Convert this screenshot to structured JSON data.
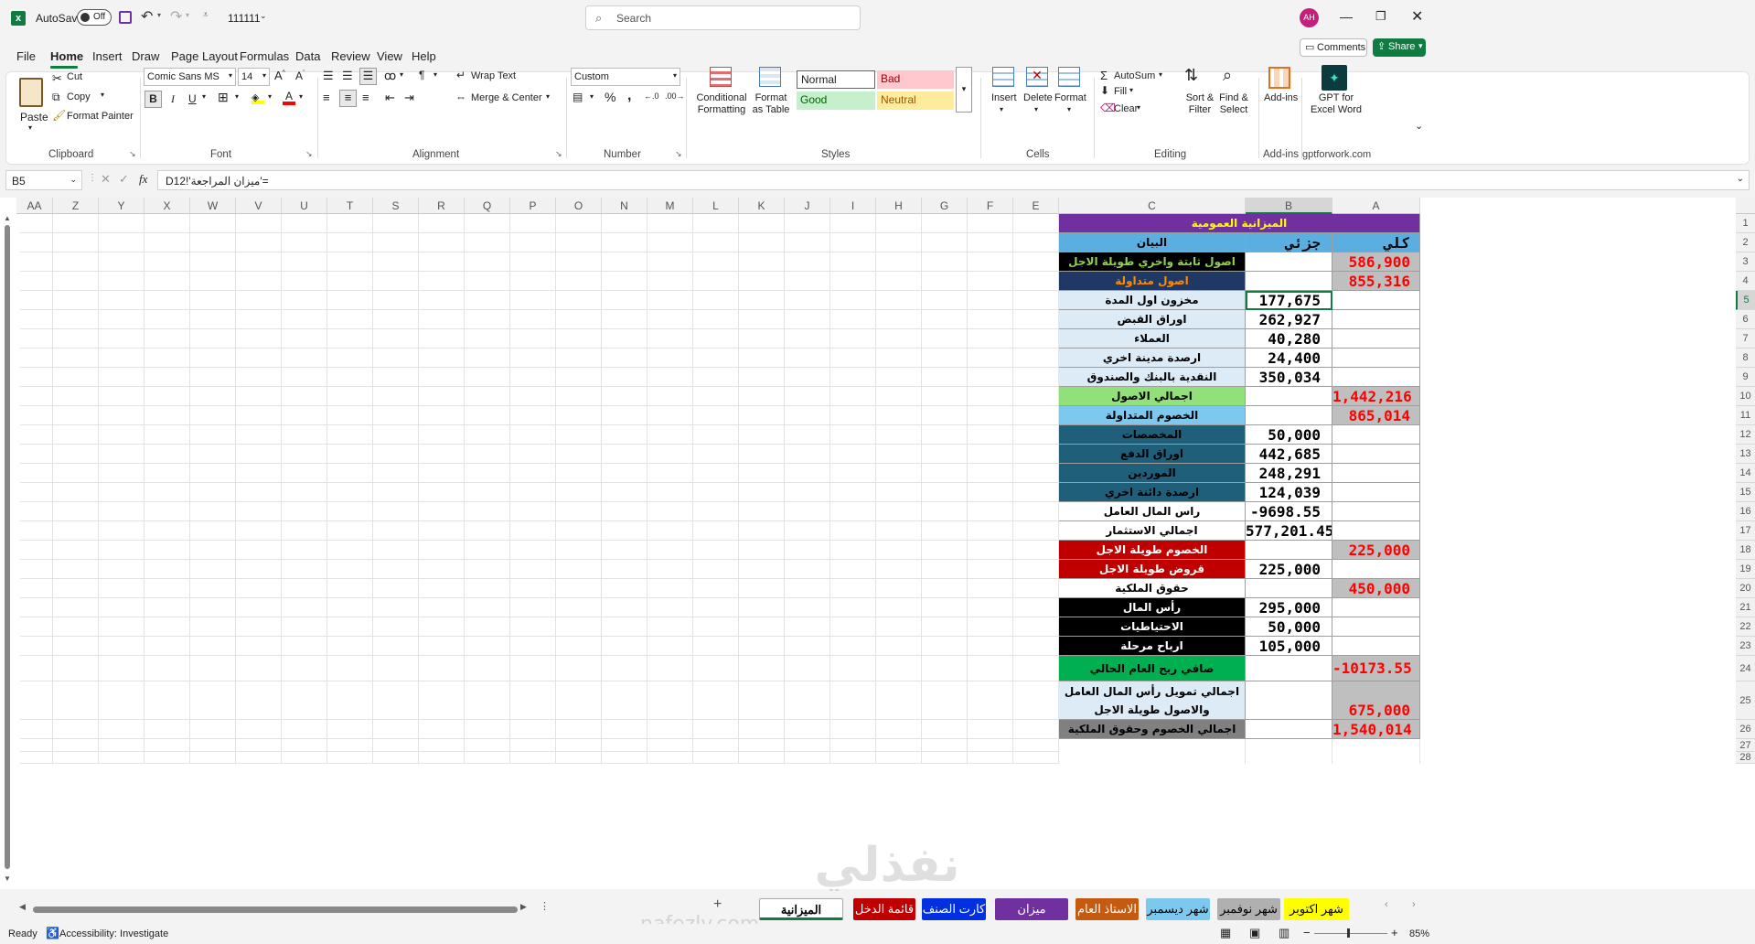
{
  "titlebar": {
    "autosave_label": "AutoSave",
    "autosave_state": "Off",
    "filename": "111111",
    "search_placeholder": "Search",
    "user_initials": "AH"
  },
  "ribbon_tabs": [
    "File",
    "Home",
    "Insert",
    "Draw",
    "Page Layout",
    "Formulas",
    "Data",
    "Review",
    "View",
    "Help"
  ],
  "active_tab": "Home",
  "top_right": {
    "comments": "Comments",
    "share": "Share"
  },
  "clipboard": {
    "paste": "Paste",
    "cut": "Cut",
    "copy": "Copy",
    "format_painter": "Format Painter",
    "label": "Clipboard"
  },
  "font": {
    "name": "Comic Sans MS",
    "size": "14",
    "label": "Font",
    "bold": "B",
    "italic": "I",
    "underline": "U"
  },
  "alignment": {
    "wrap_text": "Wrap Text",
    "merge_center": "Merge & Center",
    "label": "Alignment"
  },
  "number": {
    "format": "Custom",
    "label": "Number"
  },
  "styles": {
    "conditional": "Conditional Formatting",
    "format_table": "Format as Table",
    "normal": "Normal",
    "bad": "Bad",
    "good": "Good",
    "neutral": "Neutral",
    "label": "Styles"
  },
  "cells": {
    "insert": "Insert",
    "delete": "Delete",
    "format": "Format",
    "label": "Cells"
  },
  "editing": {
    "autosum": "AutoSum",
    "fill": "Fill",
    "clear": "Clear",
    "sort_filter": "Sort & Filter",
    "find_select": "Find & Select",
    "label": "Editing"
  },
  "addins": {
    "addins": "Add-ins",
    "label": "Add-ins",
    "gpt": "GPT for Excel Word",
    "gpt_label": "gptforwork.com"
  },
  "formula_bar": {
    "name_box": "B5",
    "fx": "fx",
    "formula": "='ميزان المراجعة'!D12"
  },
  "columns": [
    "AA",
    "Z",
    "Y",
    "X",
    "W",
    "V",
    "U",
    "T",
    "S",
    "R",
    "Q",
    "P",
    "O",
    "N",
    "M",
    "L",
    "K",
    "J",
    "I",
    "H",
    "G",
    "F",
    "E",
    "C",
    "B",
    "A"
  ],
  "rows": [
    {
      "n": "1",
      "c": "الميزانية العمومية",
      "b": "",
      "a": "",
      "fill": "#7030a0",
      "cc": "#ffff00",
      "bc": "#000",
      "ac": "#000",
      "merged": true
    },
    {
      "n": "2",
      "c": "البيان",
      "b": "جزئي",
      "a": "كلي",
      "fill": "#5aaee0",
      "cc": "#000",
      "bc": "#000",
      "ac": "#000",
      "bfill": "#5aaee0",
      "afill": "#5aaee0"
    },
    {
      "n": "3",
      "c": "اصول ثابتة واخري طويلة الاجل",
      "b": "",
      "a": "586,900",
      "fill": "#000000",
      "cc": "#92d050",
      "bc": "#000",
      "ac": "#ff0000",
      "bfill": "#fff",
      "afill": "#bfbfbf"
    },
    {
      "n": "4",
      "c": "اصول متداولة",
      "b": "",
      "a": "855,316",
      "fill": "#1f3864",
      "cc": "#ff8c00",
      "bc": "#000",
      "ac": "#ff0000",
      "bfill": "#fff",
      "afill": "#bfbfbf"
    },
    {
      "n": "5",
      "c": "مخزون اول المدة",
      "b": "177,675",
      "a": "",
      "fill": "#ddebf7",
      "cc": "#000",
      "bc": "#000",
      "ac": "#000",
      "bfill": "#fff",
      "afill": "#fff"
    },
    {
      "n": "6",
      "c": "اوراق القبض",
      "b": "262,927",
      "a": "",
      "fill": "#ddebf7",
      "cc": "#000",
      "bc": "#000",
      "ac": "#000",
      "bfill": "#fff",
      "afill": "#fff"
    },
    {
      "n": "7",
      "c": "العملاء",
      "b": "40,280",
      "a": "",
      "fill": "#ddebf7",
      "cc": "#000",
      "bc": "#000",
      "ac": "#000",
      "bfill": "#fff",
      "afill": "#fff"
    },
    {
      "n": "8",
      "c": "ارصدة مدينة اخري",
      "b": "24,400",
      "a": "",
      "fill": "#ddebf7",
      "cc": "#000",
      "bc": "#000",
      "ac": "#000",
      "bfill": "#fff",
      "afill": "#fff"
    },
    {
      "n": "9",
      "c": "النقدية بالبنك والصندوق",
      "b": "350,034",
      "a": "",
      "fill": "#ddebf7",
      "cc": "#000",
      "bc": "#000",
      "ac": "#000",
      "bfill": "#fff",
      "afill": "#fff"
    },
    {
      "n": "10",
      "c": "اجمالي الاصول",
      "b": "",
      "a": "1,442,216",
      "fill": "#92e07a",
      "cc": "#000",
      "bc": "#000",
      "ac": "#ff0000",
      "bfill": "#fff",
      "afill": "#bfbfbf"
    },
    {
      "n": "11",
      "c": "الخصوم المتداولة",
      "b": "",
      "a": "865,014",
      "fill": "#7cc8ef",
      "cc": "#000",
      "bc": "#000",
      "ac": "#ff0000",
      "bfill": "#fff",
      "afill": "#bfbfbf"
    },
    {
      "n": "12",
      "c": "المخصصات",
      "b": "50,000",
      "a": "",
      "fill": "#1f5f7a",
      "cc": "#000",
      "bc": "#000",
      "ac": "#000",
      "bfill": "#fff",
      "afill": "#fff"
    },
    {
      "n": "13",
      "c": "اوراق الدفع",
      "b": "442,685",
      "a": "",
      "fill": "#1f5f7a",
      "cc": "#000",
      "bc": "#000",
      "ac": "#000",
      "bfill": "#fff",
      "afill": "#fff"
    },
    {
      "n": "14",
      "c": "الموردين",
      "b": "248,291",
      "a": "",
      "fill": "#1f5f7a",
      "cc": "#000",
      "bc": "#000",
      "ac": "#000",
      "bfill": "#fff",
      "afill": "#fff"
    },
    {
      "n": "15",
      "c": "ارصدة دائنة اخري",
      "b": "124,039",
      "a": "",
      "fill": "#1f5f7a",
      "cc": "#000",
      "bc": "#000",
      "ac": "#000",
      "bfill": "#fff",
      "afill": "#fff"
    },
    {
      "n": "16",
      "c": "راس المال العامل",
      "b": "-9698.55",
      "a": "",
      "fill": "#ffffff",
      "cc": "#000",
      "bc": "#000",
      "ac": "#000",
      "bfill": "#fff",
      "afill": "#fff"
    },
    {
      "n": "17",
      "c": "اجمالي الاستثمار",
      "b": "577,201.45",
      "a": "",
      "fill": "#ffffff",
      "cc": "#000",
      "bc": "#000",
      "ac": "#000",
      "bfill": "#fff",
      "afill": "#fff"
    },
    {
      "n": "18",
      "c": "الخصوم طويلة الاجل",
      "b": "",
      "a": "225,000",
      "fill": "#c00000",
      "cc": "#ffffff",
      "bc": "#000",
      "ac": "#ff0000",
      "bfill": "#fff",
      "afill": "#bfbfbf"
    },
    {
      "n": "19",
      "c": "قروض طويلة الاجل",
      "b": "225,000",
      "a": "",
      "fill": "#c00000",
      "cc": "#ffffff",
      "bc": "#000",
      "ac": "#000",
      "bfill": "#fff",
      "afill": "#fff"
    },
    {
      "n": "20",
      "c": "حقوق الملكية",
      "b": "",
      "a": "450,000",
      "fill": "#ffffff",
      "cc": "#000",
      "bc": "#000",
      "ac": "#ff0000",
      "bfill": "#fff",
      "afill": "#bfbfbf"
    },
    {
      "n": "21",
      "c": "رأس المال",
      "b": "295,000",
      "a": "",
      "fill": "#000000",
      "cc": "#ffffff",
      "bc": "#000",
      "ac": "#000",
      "bfill": "#fff",
      "afill": "#fff"
    },
    {
      "n": "22",
      "c": "الاحتياطيات",
      "b": "50,000",
      "a": "",
      "fill": "#000000",
      "cc": "#ffffff",
      "bc": "#000",
      "ac": "#000",
      "bfill": "#fff",
      "afill": "#fff"
    },
    {
      "n": "23",
      "c": "ارباح مرحلة",
      "b": "105,000",
      "a": "",
      "fill": "#000000",
      "cc": "#ffffff",
      "bc": "#000",
      "ac": "#000",
      "bfill": "#fff",
      "afill": "#fff"
    },
    {
      "n": "24",
      "c": "صافي ربح العام الحالي",
      "b": "",
      "a": "-10173.55",
      "fill": "#00b050",
      "cc": "#000",
      "bc": "#000",
      "ac": "#ff0000",
      "bfill": "#fff",
      "afill": "#bfbfbf"
    },
    {
      "n": "25",
      "c": "اجمالي تمويل رأس المال العامل والاصول طويلة الاجل",
      "b": "",
      "a": "675,000",
      "fill": "#ddebf7",
      "cc": "#000",
      "bc": "#000",
      "ac": "#ff0000",
      "bfill": "#fff",
      "afill": "#bfbfbf"
    },
    {
      "n": "26",
      "c": "اجمالي الخصوم وحقوق الملكية",
      "b": "",
      "a": "1,540,014",
      "fill": "#808080",
      "cc": "#000",
      "bc": "#000",
      "ac": "#ff0000",
      "bfill": "#fff",
      "afill": "#bfbfbf"
    },
    {
      "n": "27",
      "c": "",
      "b": "",
      "a": ""
    },
    {
      "n": "28",
      "c": "",
      "b": "",
      "a": ""
    }
  ],
  "sheet_tabs": [
    {
      "label": "شهر اكتوبر",
      "bg": "#ffff00",
      "fg": "#000"
    },
    {
      "label": "شهر نوفمبر",
      "bg": "#b0b0b0",
      "fg": "#000"
    },
    {
      "label": "شهر ديسمبر",
      "bg": "#7cc8ef",
      "fg": "#000"
    },
    {
      "label": "الاستاذ العام",
      "bg": "#c55a11",
      "fg": "#fff"
    },
    {
      "label": "ميزان المراجعة",
      "bg": "#7030a0",
      "fg": "#fff"
    },
    {
      "label": "كارت الصنف",
      "bg": "#0030e0",
      "fg": "#fff"
    },
    {
      "label": "قائمة الدخل",
      "bg": "#c00000",
      "fg": "#fff"
    },
    {
      "label": "الميزانية العمومية",
      "bg": "#ffffff",
      "fg": "#000"
    }
  ],
  "status": {
    "ready": "Ready",
    "accessibility": "Accessibility: Investigate",
    "zoom": "85%"
  },
  "watermark": {
    "arabic": "نفذلي",
    "latin": "nafezly.com"
  }
}
